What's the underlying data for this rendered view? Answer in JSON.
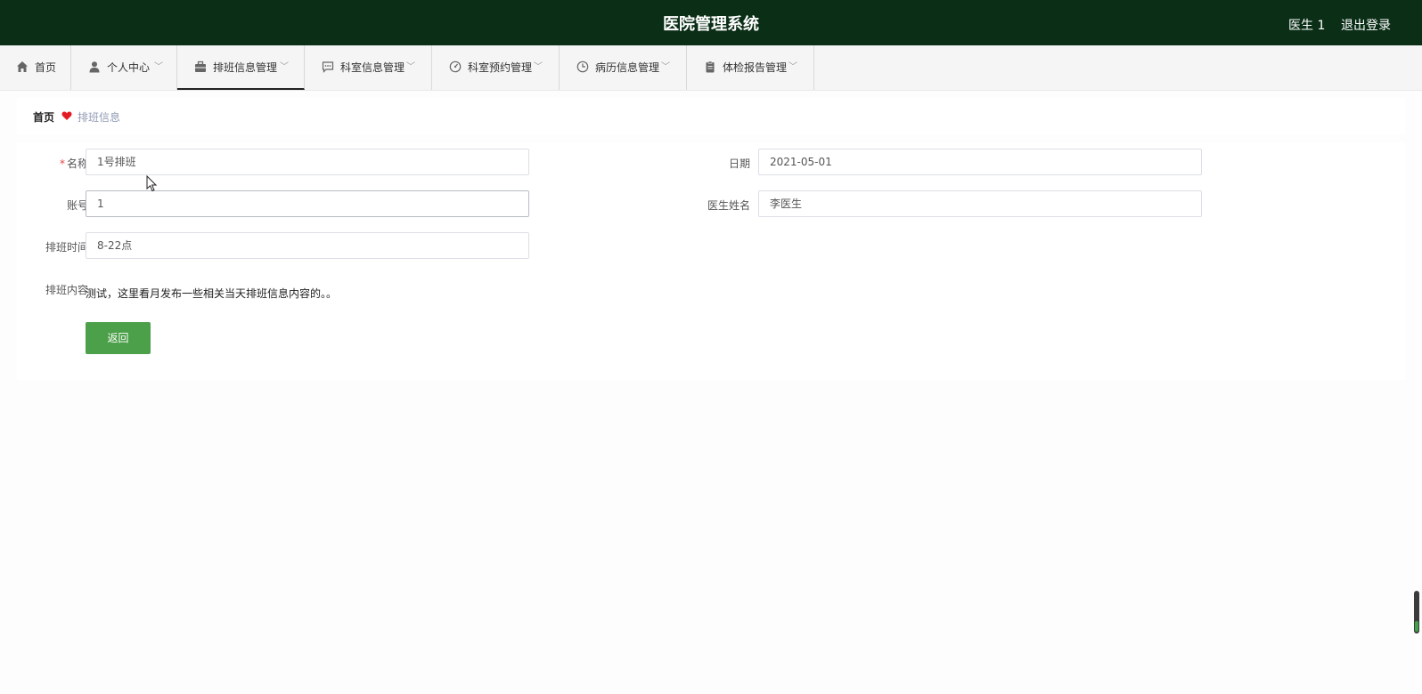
{
  "header": {
    "title": "医院管理系统",
    "user": "医生 1",
    "logout": "退出登录"
  },
  "nav": {
    "items": [
      {
        "label": "首页",
        "icon": "home-icon"
      },
      {
        "label": "个人中心",
        "icon": "user-icon"
      },
      {
        "label": "排班信息管理",
        "icon": "briefcase-icon"
      },
      {
        "label": "科室信息管理",
        "icon": "chat-icon"
      },
      {
        "label": "科室预约管理",
        "icon": "gauge-icon"
      },
      {
        "label": "病历信息管理",
        "icon": "clock-icon"
      },
      {
        "label": "体检报告管理",
        "icon": "clipboard-icon"
      }
    ],
    "active_index": 2
  },
  "breadcrumb": {
    "home": "首页",
    "current": "排班信息"
  },
  "form": {
    "name_label": "名称",
    "name_value": "1号排班",
    "date_label": "日期",
    "date_value": "2021-05-01",
    "account_label": "账号",
    "account_value": "1",
    "doctor_label": "医生姓名",
    "doctor_value": "李医生",
    "time_label": "排班时间",
    "time_value": "8-22点",
    "content_label": "排班内容",
    "content_value": "测试，这里看月发布一些相关当天排班信息内容的。。",
    "back_button": "返回"
  },
  "colors": {
    "header_bg": "#0b2e17",
    "accent_green": "#4da04a",
    "required": "#e64242"
  }
}
